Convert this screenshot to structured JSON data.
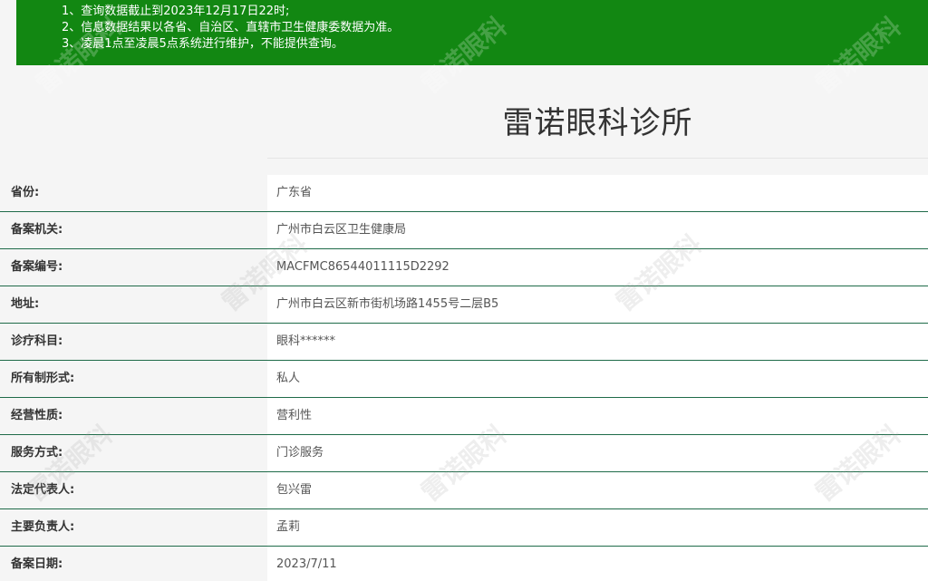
{
  "notice": {
    "lines": [
      "1、查询数据截止到2023年12月17日22时;",
      "2、信息数据结果以各省、自治区、直辖市卫生健康委数据为准。",
      "3、凌晨1点至凌晨5点系统进行维护，不能提供查询。"
    ]
  },
  "title": "雷诺眼科诊所",
  "watermark": "雷诺眼科",
  "rows": [
    {
      "label": "省份:",
      "value": "广东省"
    },
    {
      "label": "备案机关:",
      "value": "广州市白云区卫生健康局"
    },
    {
      "label": "备案编号:",
      "value": "MACFMC86544011115D2292"
    },
    {
      "label": "地址:",
      "value": "广州市白云区新市街机场路1455号二层B5"
    },
    {
      "label": "诊疗科目:",
      "value": "眼科******"
    },
    {
      "label": "所有制形式:",
      "value": "私人"
    },
    {
      "label": "经营性质:",
      "value": "营利性"
    },
    {
      "label": "服务方式:",
      "value": "门诊服务"
    },
    {
      "label": "法定代表人:",
      "value": "包兴雷"
    },
    {
      "label": "主要负责人:",
      "value": "孟莉"
    },
    {
      "label": "备案日期:",
      "value": "2023/7/11"
    }
  ],
  "colors": {
    "notice_bg": "#128712",
    "row_border": "#1f6b49"
  }
}
